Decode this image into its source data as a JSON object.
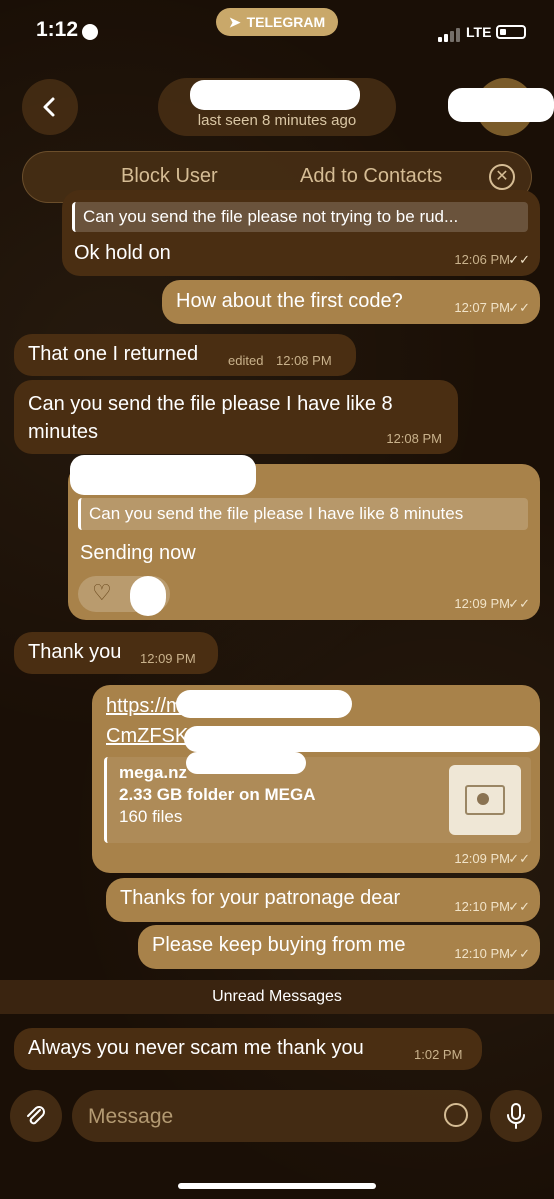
{
  "status": {
    "time": "1:12",
    "banner_app": "TELEGRAM",
    "network": "LTE"
  },
  "header": {
    "last_seen": "last seen 8 minutes ago"
  },
  "actions": {
    "block": "Block User",
    "add_contacts": "Add to Contacts"
  },
  "messages": [
    {
      "dir": "in",
      "reply": "Can you send the file please not trying to be rud...",
      "text": "Ok hold on",
      "time": "12:06 PM"
    },
    {
      "dir": "out",
      "text": "How about the first code?",
      "time": "12:07 PM"
    },
    {
      "dir": "in",
      "text": "That one I returned",
      "edited": "edited",
      "time": "12:08 PM"
    },
    {
      "dir": "in",
      "text": "Can you send the file please I have like 8 minutes",
      "time": "12:08 PM"
    },
    {
      "dir": "out",
      "reply": "Can you send the file please I have like 8 minutes",
      "text": "Sending now",
      "time": "12:09 PM"
    },
    {
      "dir": "in",
      "text": "Thank you",
      "time": "12:09 PM"
    },
    {
      "dir": "out",
      "link_line1": "https://meg",
      "link_line2": "CmZFSK4",
      "preview_site": "mega.nz",
      "preview_title": "2.33 GB folder on MEGA",
      "preview_desc": "160 files",
      "time": "12:09 PM"
    },
    {
      "dir": "out",
      "text": "Thanks for your patronage dear",
      "time": "12:10 PM"
    },
    {
      "dir": "out",
      "text": "Please keep buying from me",
      "time": "12:10 PM"
    },
    {
      "dir": "in",
      "text": "Always you never scam me thank you",
      "time": "1:02 PM"
    }
  ],
  "unread_banner": "Unread Messages",
  "input": {
    "placeholder": "Message"
  },
  "icons": {
    "back": "chevron-left-icon",
    "attach": "paperclip-icon",
    "sticker": "sticker-icon",
    "mic": "microphone-icon",
    "close": "close-icon",
    "heart": "heart-icon"
  },
  "colors": {
    "incoming": "#4a2e12",
    "outgoing": "#a8824a",
    "accent": "#c9a86a"
  }
}
